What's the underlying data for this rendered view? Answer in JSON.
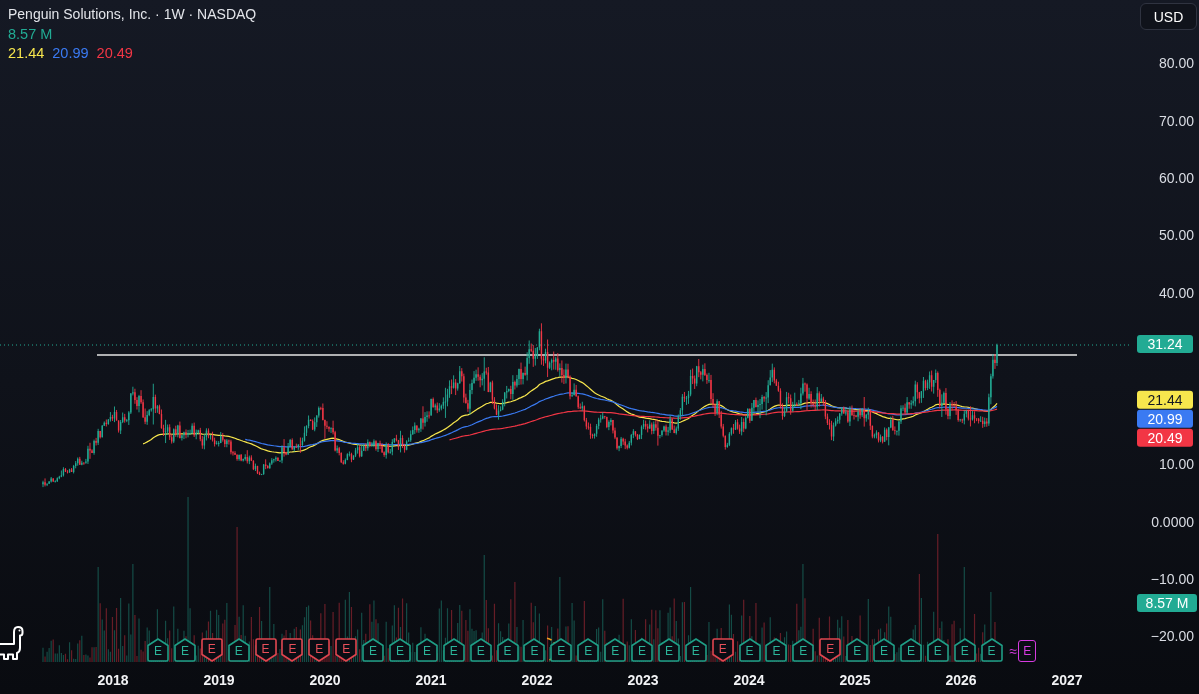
{
  "legend": {
    "title": "Penguin Solutions, Inc. · 1W · NASDAQ",
    "volume": "8.57 M",
    "values": [
      {
        "text": "21.44",
        "color": "#f7e64d"
      },
      {
        "text": "20.99",
        "color": "#3a7af2"
      },
      {
        "text": "20.49",
        "color": "#f23645"
      }
    ]
  },
  "currency_button": {
    "label": "USD"
  },
  "price_axis": [
    {
      "kind": "tick",
      "text": "80.00"
    },
    {
      "kind": "tick",
      "text": "70.00"
    },
    {
      "kind": "tick",
      "text": "60.00"
    },
    {
      "kind": "tick",
      "text": "50.00"
    },
    {
      "kind": "tick",
      "text": "40.00"
    },
    {
      "kind": "last_price",
      "text": "31.24",
      "color": "#22ab94"
    },
    {
      "kind": "indicator",
      "text": "21.44",
      "color": "#f7e64d"
    },
    {
      "kind": "indicator",
      "text": "20.99",
      "color": "#3a7af2"
    },
    {
      "kind": "indicator",
      "text": "20.49",
      "color": "#f23645"
    },
    {
      "kind": "tick",
      "text": "10.00"
    },
    {
      "kind": "tick",
      "text": "0.0000"
    },
    {
      "kind": "tick",
      "text": "−10.00"
    },
    {
      "kind": "volume",
      "text": "8.57 M",
      "color": "#22ab94"
    },
    {
      "kind": "tick",
      "text": "−20.00"
    }
  ],
  "earnings": [
    {
      "label": "E",
      "kind": "beat"
    },
    {
      "label": "E",
      "kind": "beat"
    },
    {
      "label": "E",
      "kind": "miss"
    },
    {
      "label": "E",
      "kind": "beat"
    },
    {
      "label": "E",
      "kind": "miss"
    },
    {
      "label": "E",
      "kind": "miss"
    },
    {
      "label": "E",
      "kind": "miss"
    },
    {
      "label": "E",
      "kind": "miss"
    },
    {
      "label": "E",
      "kind": "beat"
    },
    {
      "label": "E",
      "kind": "beat"
    },
    {
      "label": "E",
      "kind": "beat"
    },
    {
      "label": "E",
      "kind": "beat"
    },
    {
      "label": "E",
      "kind": "beat"
    },
    {
      "label": "E",
      "kind": "beat"
    },
    {
      "label": "E",
      "kind": "beat"
    },
    {
      "label": "E",
      "kind": "beat"
    },
    {
      "label": "E",
      "kind": "beat"
    },
    {
      "label": "E",
      "kind": "beat"
    },
    {
      "label": "E",
      "kind": "beat"
    },
    {
      "label": "E",
      "kind": "beat"
    },
    {
      "label": "E",
      "kind": "beat"
    },
    {
      "label": "E",
      "kind": "miss"
    },
    {
      "label": "E",
      "kind": "beat"
    },
    {
      "label": "E",
      "kind": "beat"
    },
    {
      "label": "E",
      "kind": "beat"
    },
    {
      "label": "E",
      "kind": "miss"
    },
    {
      "label": "E",
      "kind": "beat"
    },
    {
      "label": "E",
      "kind": "beat"
    },
    {
      "label": "E",
      "kind": "beat"
    },
    {
      "label": "E",
      "kind": "beat"
    },
    {
      "label": "E",
      "kind": "beat"
    },
    {
      "label": "E",
      "kind": "beat"
    },
    {
      "label": "E",
      "kind": "upcoming",
      "prefix": "≈"
    }
  ],
  "time_axis": [
    "2018",
    "2019",
    "2020",
    "2021",
    "2022",
    "2023",
    "2024",
    "2025",
    "2026",
    "2027"
  ]
}
